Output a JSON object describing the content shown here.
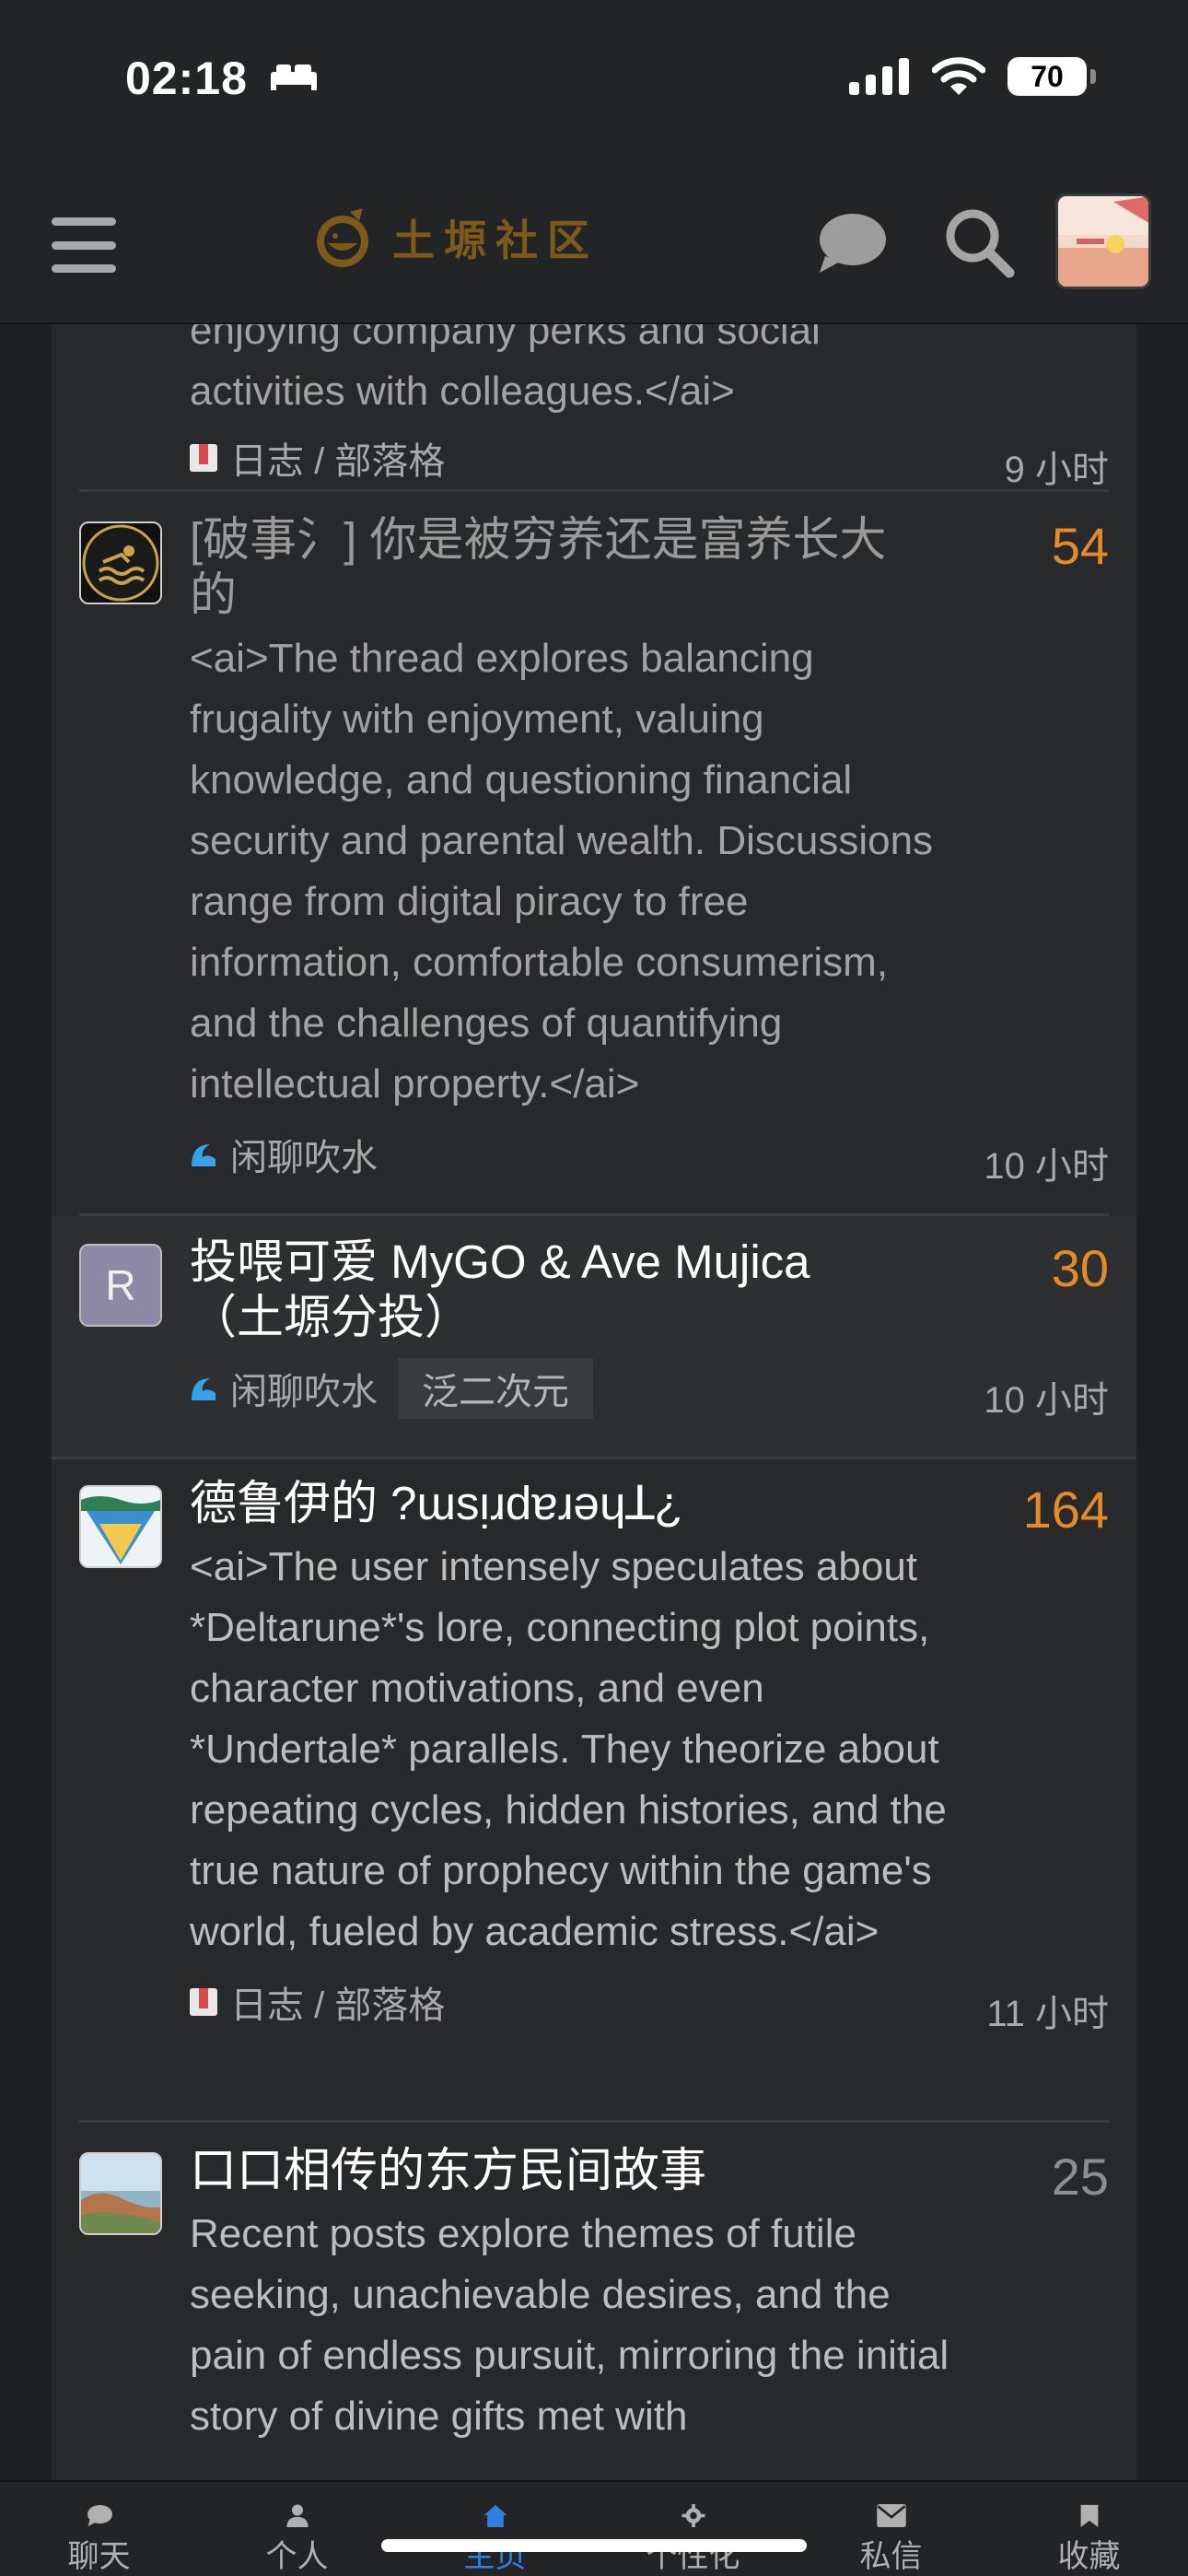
{
  "status": {
    "time": "02:18",
    "battery": "70"
  },
  "header": {
    "logo_text": "土塬社区"
  },
  "topics": [
    {
      "excerpt": "enjoying company perks and social activities with colleagues.</ai>",
      "category": "日志 / 部落格",
      "age": "9 小时"
    },
    {
      "title": "[破事氵] 你是被穷养还是富养长大的",
      "excerpt": "<ai>The thread explores balancing frugality with enjoyment, valuing knowledge, and questioning financial security and parental wealth. Discussions range from digital piracy to free information, comfortable consumerism, and the challenges of quantifying intellectual property.</ai>",
      "posts": "54",
      "category": "闲聊吹水",
      "age": "10 小时"
    },
    {
      "title": "投喂可爱 MyGO & Ave Mujica （土塬分投）",
      "avatar_letter": "R",
      "posts": "30",
      "category": "闲聊吹水",
      "tag": "泛二次元",
      "age": "10 小时"
    },
    {
      "title": "德鲁伊的 ?ɯsᴉɹdɐɹǝɥꓕ¿",
      "excerpt": "<ai>The user intensely speculates about *Deltarune*'s lore, connecting plot points, character motivations, and even *Undertale* parallels. They theorize about repeating cycles, hidden histories, and the true nature of prophecy within the game's world, fueled by academic stress.</ai>",
      "posts": "164",
      "category": "日志 / 部落格",
      "age": "11 小时"
    },
    {
      "title": "口口相传的东方民间故事",
      "excerpt": "Recent posts explore themes of futile seeking, unachievable desires, and the pain of endless pursuit, mirroring the initial story of divine gifts met with",
      "posts": "25"
    }
  ],
  "nav": [
    {
      "label": "聊天",
      "icon": "chat-icon"
    },
    {
      "label": "个人",
      "icon": "user-icon"
    },
    {
      "label": "主页",
      "icon": "home-icon"
    },
    {
      "label": "个性化",
      "icon": "gear-icon"
    },
    {
      "label": "私信",
      "icon": "mail-icon"
    },
    {
      "label": "收藏",
      "icon": "bookmark-icon"
    }
  ],
  "colors": {
    "accent": "#e58a2a",
    "nav_active": "#2f7fe0",
    "logo": "#7d5a1a"
  }
}
